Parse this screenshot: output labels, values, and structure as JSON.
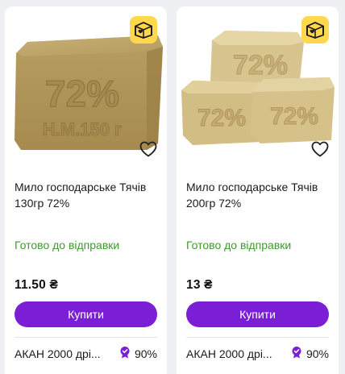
{
  "products": [
    {
      "title": "Мило господарське Тячів 130гр 72%",
      "image_text_top": "72%",
      "image_text_bottom": "Н.М.150 г",
      "stock_status": "Готово до відправки",
      "price": "11.50 ₴",
      "buy_label": "Купити",
      "seller": "АКАН 2000 дрі...",
      "rating": "90%"
    },
    {
      "title": "Мило господарське Тячів 200гр 72%",
      "image_text_top": "72%",
      "stock_status": "Готово до відправки",
      "price": "13 ₴",
      "buy_label": "Купити",
      "seller": "АКАН 2000 дрі...",
      "rating": "90%"
    }
  ],
  "colors": {
    "accent": "#7a1fd6",
    "stock_green": "#3f9b2d",
    "badge_yellow": "#ffd84d",
    "background": "#eef0f3"
  },
  "icons": [
    "delivery-box-icon",
    "heart-icon",
    "rating-badge-icon"
  ]
}
